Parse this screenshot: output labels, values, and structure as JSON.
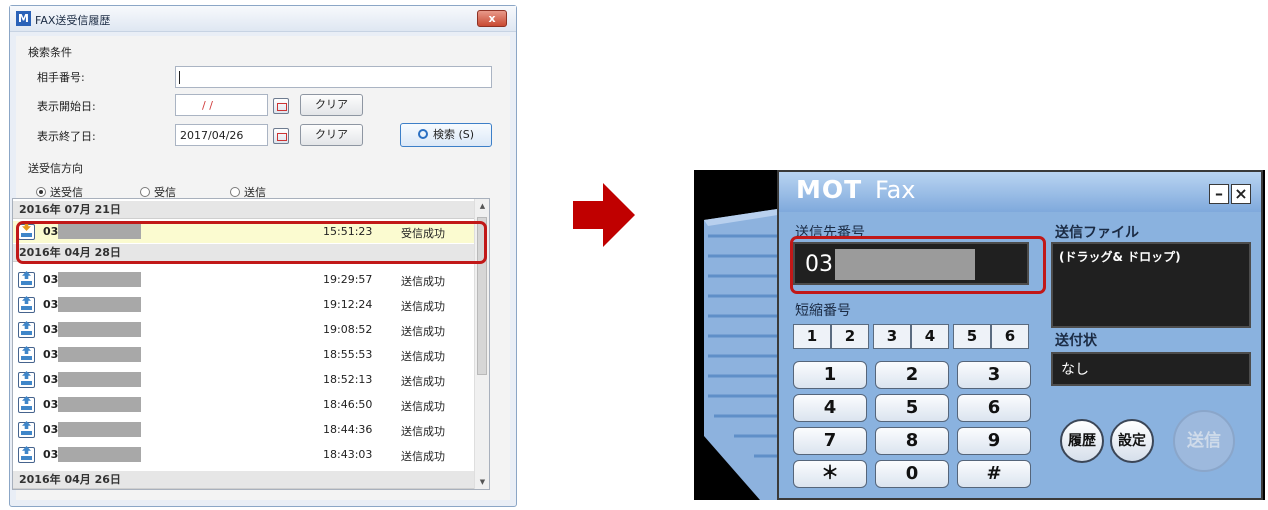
{
  "history_dialog": {
    "title": "FAX送受信履歴",
    "app_icon_letter": "M",
    "close_label": "x",
    "search": {
      "group_label": "検索条件",
      "number_label": "相手番号:",
      "number_value": "",
      "start_label": "表示開始日:",
      "start_value": "/ /",
      "end_label": "表示終了日:",
      "end_value": "2017/04/26",
      "clear_label": "クリア",
      "search_button": "検索 (S)"
    },
    "direction": {
      "group_label": "送受信方向",
      "options": [
        "送受信",
        "受信",
        "送信"
      ],
      "selected": "送受信"
    },
    "list": {
      "date_headers": [
        "2016年 07月 21日",
        "2016年 04月 28日",
        "2016年 04月 26日"
      ],
      "rows": [
        {
          "number": "03",
          "time": "15:51:23",
          "status": "受信成功",
          "direction": "in"
        },
        {
          "number": "03",
          "time": "19:29:57",
          "status": "送信成功",
          "direction": "out"
        },
        {
          "number": "03",
          "time": "19:12:24",
          "status": "送信成功",
          "direction": "out"
        },
        {
          "number": "03",
          "time": "19:08:52",
          "status": "送信成功",
          "direction": "out"
        },
        {
          "number": "03",
          "time": "18:55:53",
          "status": "送信成功",
          "direction": "out"
        },
        {
          "number": "03",
          "time": "18:52:13",
          "status": "送信成功",
          "direction": "out"
        },
        {
          "number": "03",
          "time": "18:46:50",
          "status": "送信成功",
          "direction": "out"
        },
        {
          "number": "03",
          "time": "18:44:36",
          "status": "送信成功",
          "direction": "out"
        },
        {
          "number": "03",
          "time": "18:43:03",
          "status": "送信成功",
          "direction": "out"
        }
      ]
    }
  },
  "motfax": {
    "brand_main": "MOT",
    "brand_sub": "Fax",
    "minimize_label": "–",
    "close_label": "×",
    "dest_label": "送信先番号",
    "dest_value": "03",
    "speed_label": "短縮番号",
    "speed_keys": [
      "1",
      "2",
      "3",
      "4",
      "5",
      "6"
    ],
    "file_label": "送信ファイル",
    "file_value": "(ドラッグ& ドロップ)",
    "cover_label": "送付状",
    "cover_value": "なし",
    "keypad": [
      "1",
      "2",
      "3",
      "4",
      "5",
      "6",
      "7",
      "8",
      "9",
      "＊",
      "0",
      "#"
    ],
    "history_button": "履歴",
    "settings_button": "設定",
    "send_button": "送信"
  },
  "colors": {
    "highlight": "#c11818",
    "arrow": "#c00000",
    "panel_blue": "#8ab2df"
  }
}
